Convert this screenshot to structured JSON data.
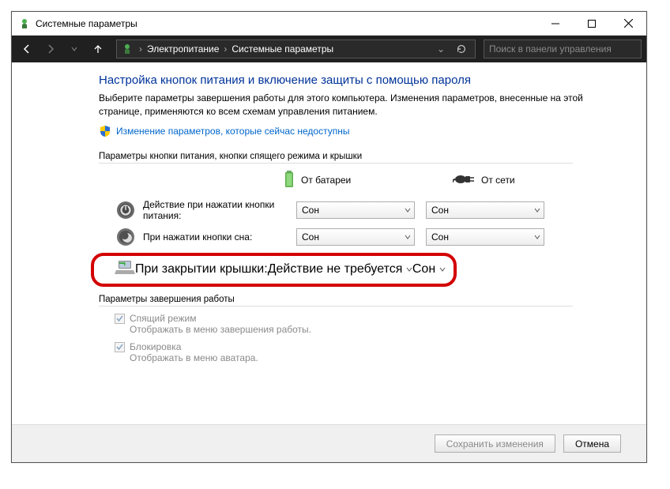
{
  "window": {
    "title": "Системные параметры"
  },
  "nav": {
    "breadcrumb": {
      "item1": "Электропитание",
      "item2": "Системные параметры"
    },
    "search_placeholder": "Поиск в панели управления"
  },
  "main": {
    "heading": "Настройка кнопок питания и включение защиты с помощью пароля",
    "description": "Выберите параметры завершения работы для этого компьютера. Изменения параметров, внесенные на этой странице, применяются ко всем схемам управления питанием.",
    "admin_link": "Изменение параметров, которые сейчас недоступны",
    "section1_title": "Параметры кнопки питания, кнопки спящего режима и крышки",
    "col_battery": "От батареи",
    "col_plugged": "От сети",
    "rows": {
      "power": {
        "label": "Действие при нажатии кнопки питания:",
        "battery": "Сон",
        "plugged": "Сон"
      },
      "sleep": {
        "label": "При нажатии кнопки сна:",
        "battery": "Сон",
        "plugged": "Сон"
      },
      "lid": {
        "label": "При закрытии крышки:",
        "battery": "Действие не требуется",
        "plugged": "Сон"
      }
    },
    "section2_title": "Параметры завершения работы",
    "checks": {
      "sleep": {
        "title": "Спящий режим",
        "sub": "Отображать в меню завершения работы."
      },
      "lock": {
        "title": "Блокировка",
        "sub": "Отображать в меню аватара."
      }
    }
  },
  "footer": {
    "save": "Сохранить изменения",
    "cancel": "Отмена"
  }
}
